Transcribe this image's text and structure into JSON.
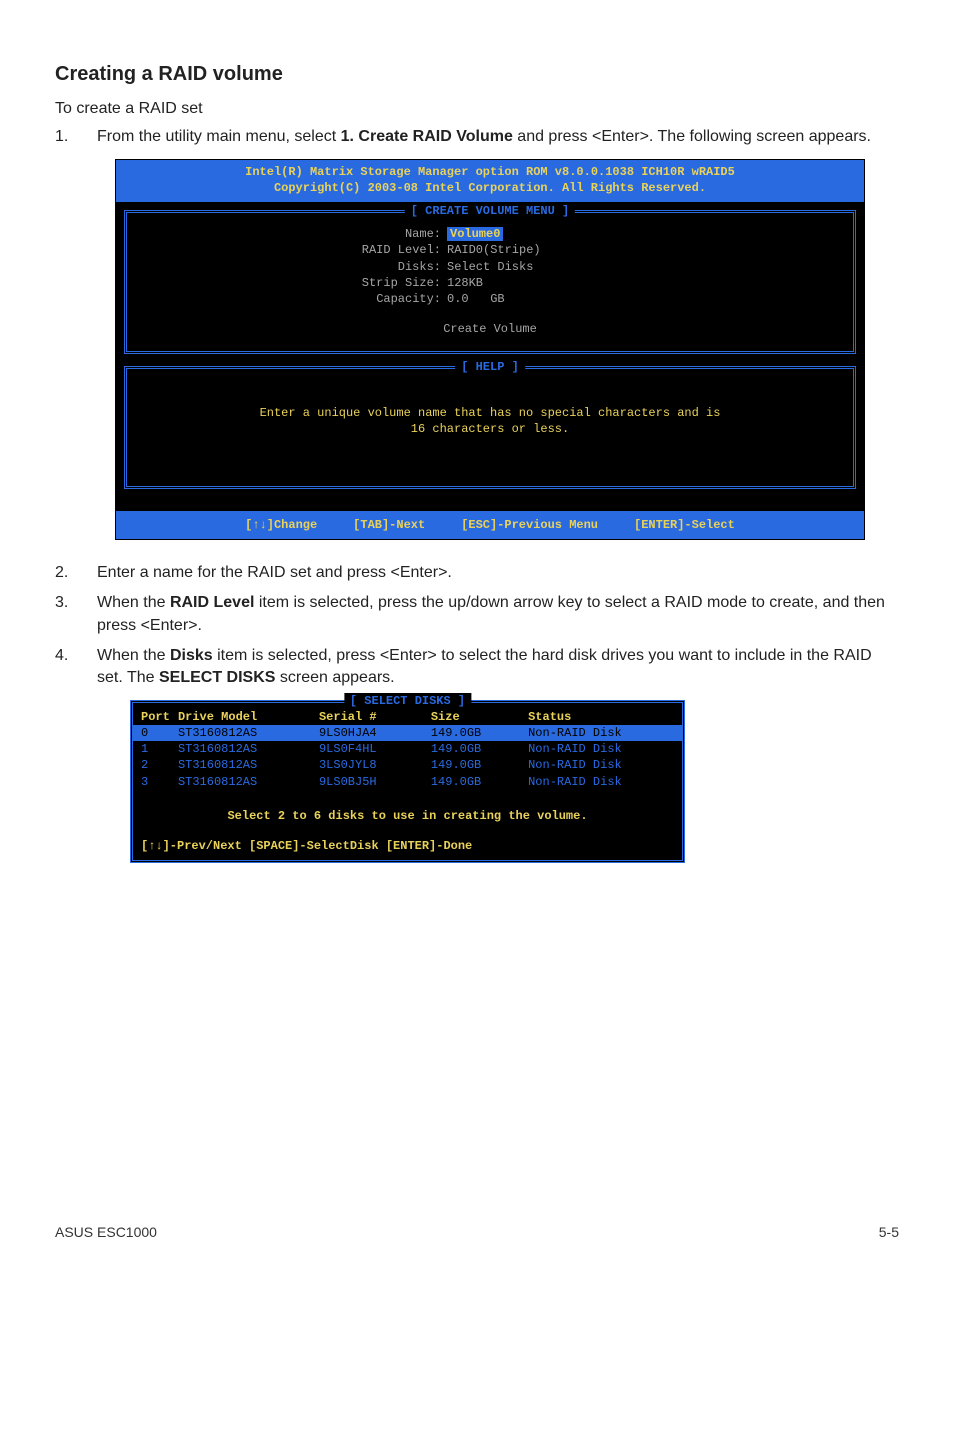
{
  "heading": "Creating a RAID volume",
  "intro": "To create a RAID set",
  "step1_num": "1.",
  "step1_before": "From the utility main menu, select ",
  "step1_bold": "1. Create RAID Volume",
  "step1_after": " and press <Enter>. The following screen appears.",
  "bios": {
    "title1": "Intel(R) Matrix Storage Manager option ROM v8.0.0.1038 ICH10R wRAID5",
    "title2": "Copyright(C) 2003-08 Intel Corporation.  All Rights Reserved.",
    "panel_create": "[ CREATE VOLUME MENU ]",
    "panel_help": "[ HELP ]",
    "name_label": "Name:",
    "name_value": "Volume0",
    "raid_label": "RAID Level:",
    "raid_value": "RAID0(Stripe)",
    "disks_label": "Disks:",
    "disks_value": "Select Disks",
    "strip_label": "Strip Size:",
    "strip_value": "128KB",
    "cap_label": "Capacity:",
    "cap_value": "0.0   GB",
    "createvol": "Create Volume",
    "help1": "Enter a unique volume name that has no special characters and is",
    "help2": "16 characters or less.",
    "f1": "[↑↓]Change",
    "f2": "[TAB]-Next",
    "f3": "[ESC]-Previous Menu",
    "f4": "[ENTER]-Select"
  },
  "step2_num": "2.",
  "step2": "Enter a name for the RAID set and press <Enter>.",
  "step3_num": "3.",
  "step3_before": "When the ",
  "step3_bold": "RAID Level",
  "step3_after": " item is selected, press the up/down arrow key to select a RAID mode to create, and then press <Enter>.",
  "step4_num": "4.",
  "step4_before": "When the ",
  "step4_bold1": "Disks",
  "step4_mid": " item is selected, press <Enter> to select the hard disk drives you want to include in the RAID set. The ",
  "step4_bold2": "SELECT DISKS",
  "step4_after": " screen appears.",
  "disks": {
    "title": "[ SELECT DISKS ]",
    "h1": "Port",
    "h2": "Drive Model",
    "h3": "Serial #",
    "h4": "Size",
    "h5": "Status",
    "rows": [
      {
        "port": "0",
        "model": "ST3160812AS",
        "serial": "9LS0HJA4",
        "size": "149.0GB",
        "status": "Non-RAID Disk"
      },
      {
        "port": "1",
        "model": "ST3160812AS",
        "serial": "9LS0F4HL",
        "size": "149.0GB",
        "status": "Non-RAID Disk"
      },
      {
        "port": "2",
        "model": "ST3160812AS",
        "serial": "3LS0JYL8",
        "size": "149.0GB",
        "status": "Non-RAID Disk"
      },
      {
        "port": "3",
        "model": "ST3160812AS",
        "serial": "9LS0BJ5H",
        "size": "149.0GB",
        "status": "Non-RAID Disk"
      }
    ],
    "note": "Select 2 to 6 disks to use in creating the volume.",
    "footer": "[↑↓]-Prev/Next [SPACE]-SelectDisk [ENTER]-Done"
  },
  "footer_left": "ASUS ESC1000",
  "footer_right": "5-5"
}
